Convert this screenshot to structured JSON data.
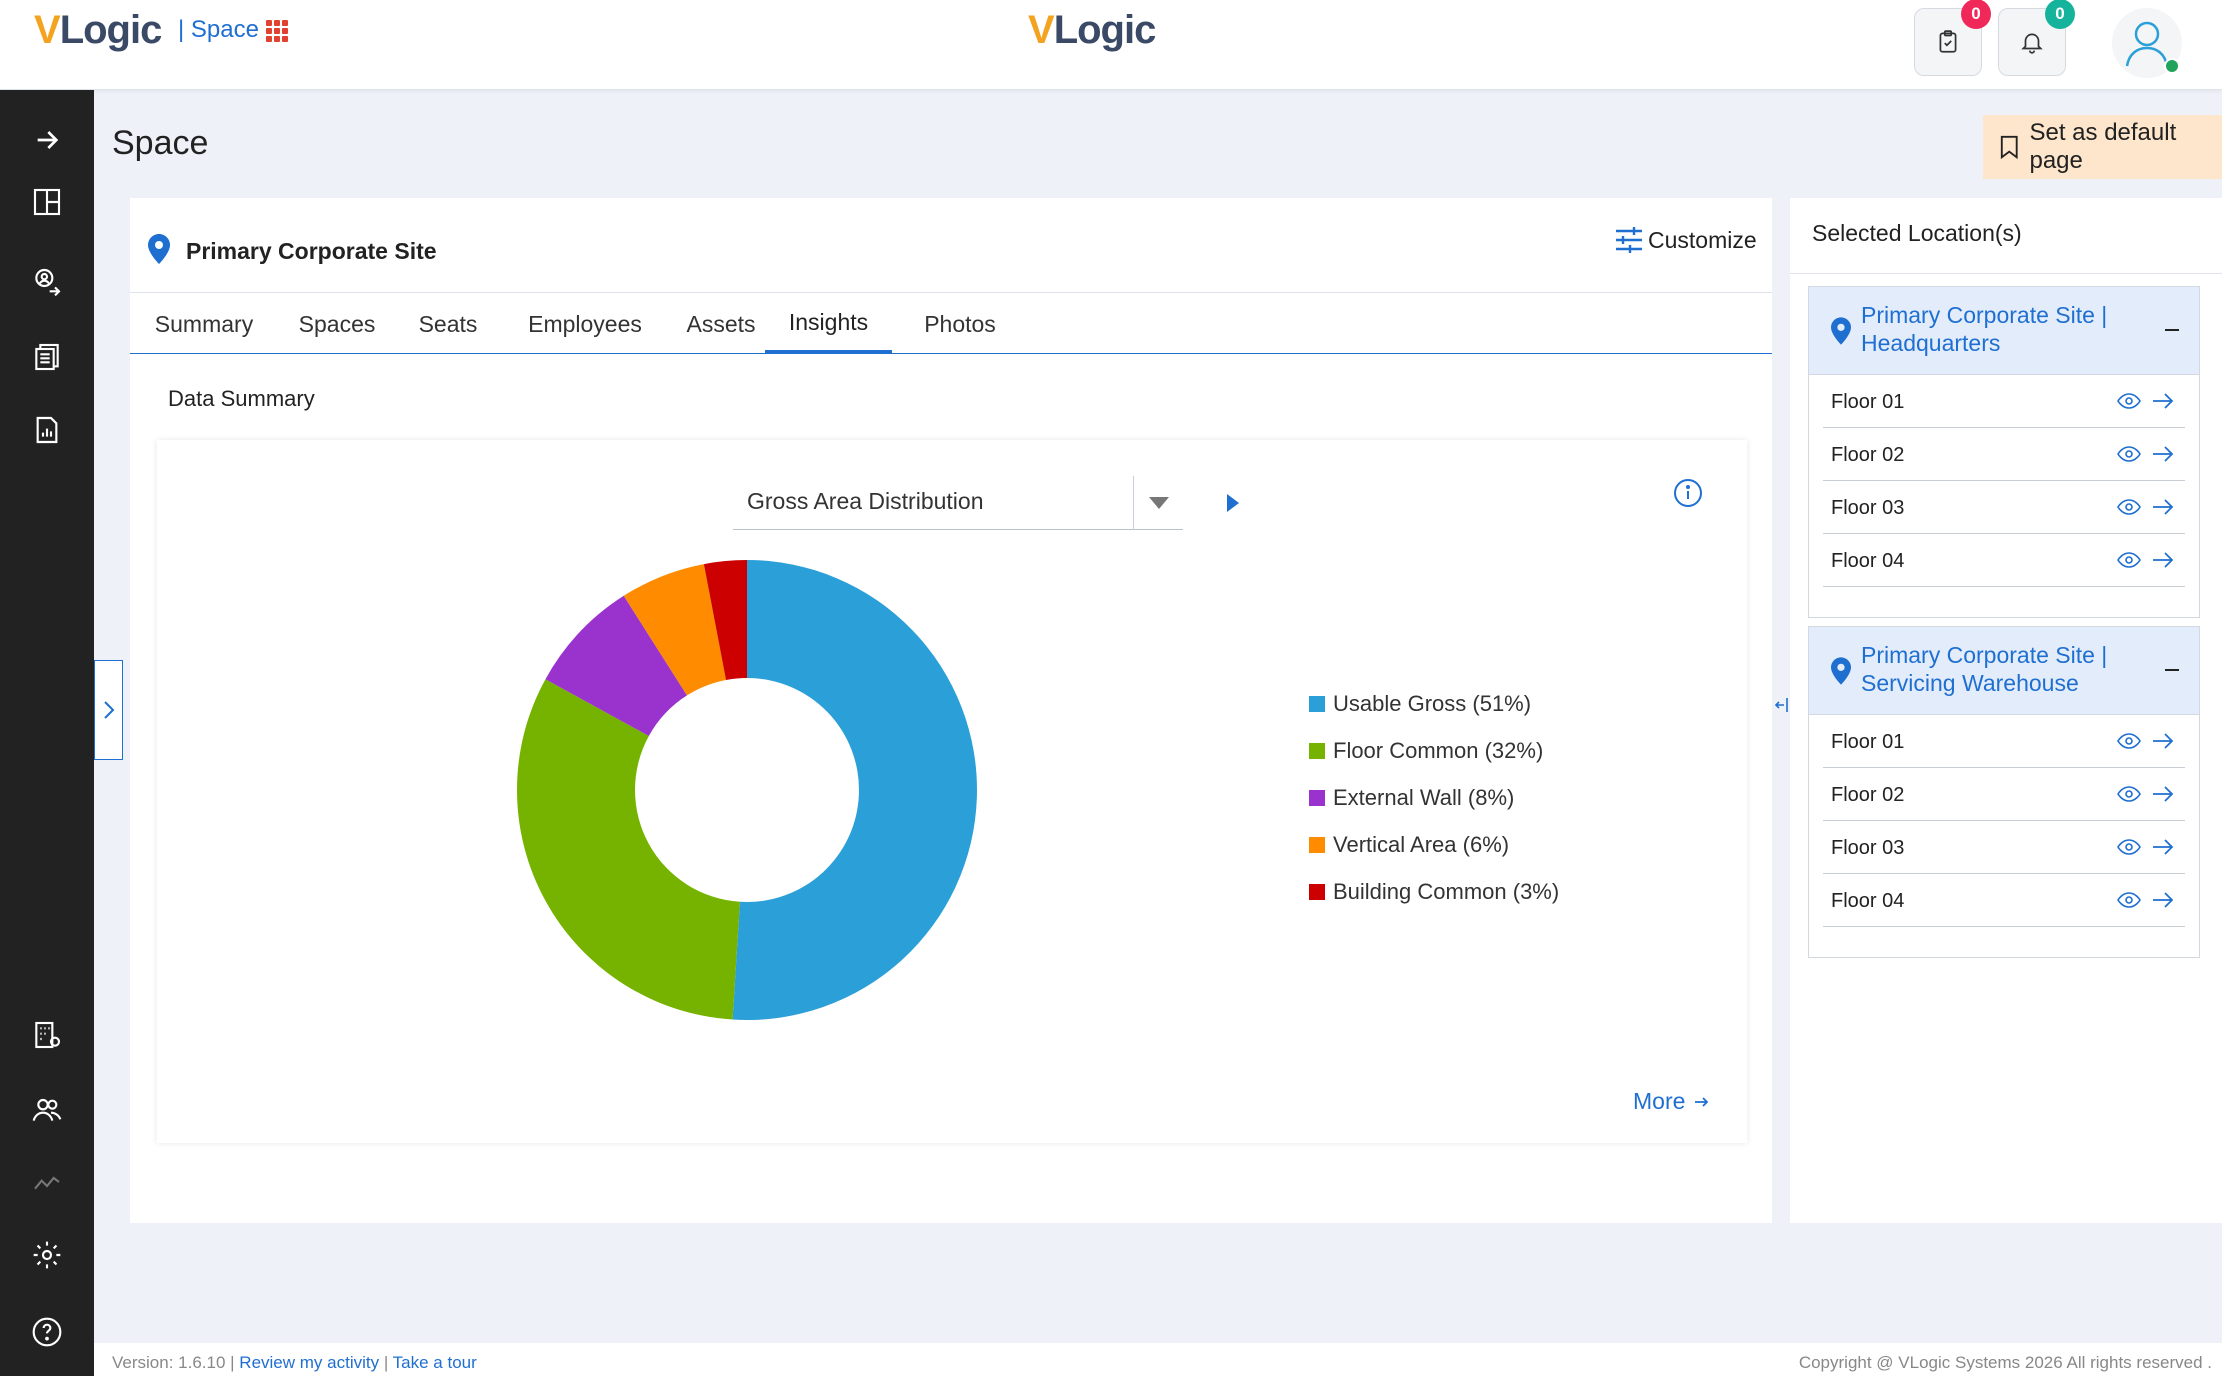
{
  "header": {
    "logo_v": "V",
    "logo_rest": "Logic",
    "app_separator": "|",
    "app_name": "Space",
    "tasks_badge": "0",
    "notifications_badge": "0"
  },
  "colors": {
    "brand_blue": "#1f6fd1",
    "logo_orange": "#f4a321",
    "sidebar_bg": "#222222",
    "badge_red": "#f0285a",
    "badge_green": "#16b39c",
    "default_btn_bg": "#fde6cc"
  },
  "page": {
    "title": "Space",
    "set_default_label": "Set as default page"
  },
  "main": {
    "site_title": "Primary Corporate Site",
    "customize_label": "Customize",
    "tabs": [
      {
        "label": "Summary"
      },
      {
        "label": "Spaces"
      },
      {
        "label": "Seats"
      },
      {
        "label": "Employees"
      },
      {
        "label": "Assets"
      },
      {
        "label": "Insights"
      },
      {
        "label": "Photos"
      }
    ],
    "active_tab": "Insights",
    "section_title": "Data Summary",
    "chart_selector": "Gross Area Distribution",
    "more_label": "More"
  },
  "chart_data": {
    "type": "pie",
    "donut": true,
    "categories": [
      "Usable Gross",
      "Floor Common",
      "External Wall",
      "Vertical Area",
      "Building Common"
    ],
    "values": [
      51,
      32,
      8,
      6,
      3
    ],
    "legend_labels": [
      "Usable Gross (51%)",
      "Floor Common (32%)",
      "External Wall (8%)",
      "Vertical Area (6%)",
      "Building Common (3%)"
    ],
    "colors": [
      "#2b9fd8",
      "#76b300",
      "#9a32cd",
      "#ff8c00",
      "#cc0000"
    ],
    "legend_position": "right"
  },
  "right_panel": {
    "title": "Selected Location(s)",
    "groups": [
      {
        "name": "Primary Corporate Site | Headquarters",
        "floors": [
          "Floor 01",
          "Floor 02",
          "Floor 03",
          "Floor 04"
        ]
      },
      {
        "name": "Primary Corporate Site | Servicing Warehouse",
        "floors": [
          "Floor 01",
          "Floor 02",
          "Floor 03",
          "Floor 04"
        ]
      }
    ]
  },
  "footer": {
    "version": "Version: 1.6.10",
    "review_link": "Review my activity",
    "tour_link": "Take a tour",
    "copyright": "Copyright @ VLogic Systems 2026 All rights reserved ."
  },
  "icons": {
    "sidebar": [
      "arrow-right-icon",
      "dashboard-icon",
      "person-move-icon",
      "documents-icon",
      "report-icon",
      "building-settings-icon",
      "users-icon",
      "trend-icon",
      "gear-icon",
      "help-icon"
    ]
  }
}
